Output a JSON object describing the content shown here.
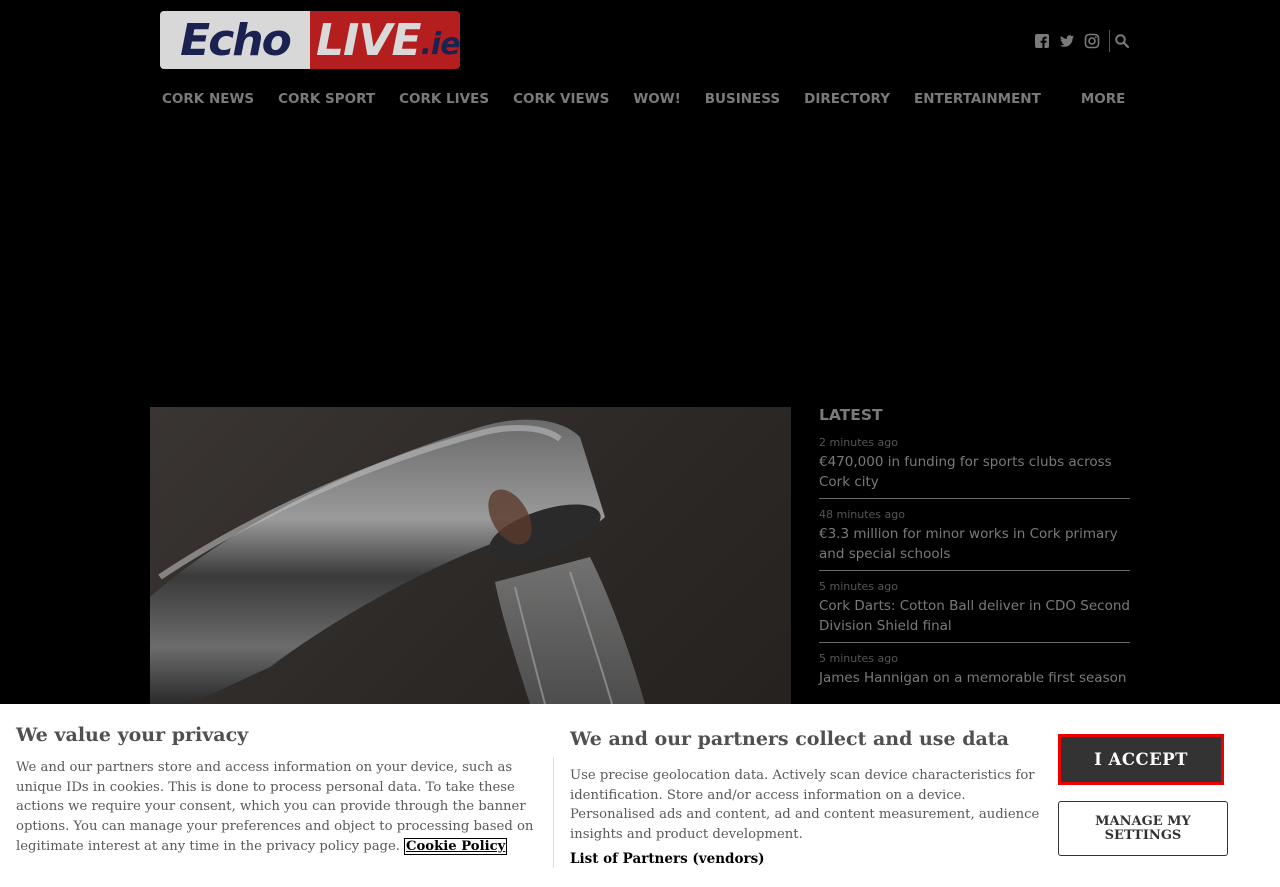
{
  "logo": {
    "part1": "Echo",
    "part2": "LIVE",
    "part3": ".ie"
  },
  "social": {
    "icons": [
      "facebook-icon",
      "twitter-icon",
      "instagram-icon",
      "search-icon"
    ]
  },
  "nav": {
    "items": [
      "CORK NEWS",
      "CORK SPORT",
      "CORK LIVES",
      "CORK VIEWS",
      "WOW!",
      "BUSINESS",
      "DIRECTORY",
      "ENTERTAINMENT"
    ],
    "more": "MORE"
  },
  "latest": {
    "heading": "LATEST",
    "entries": [
      {
        "time": "2 minutes ago",
        "title": "€470,000 in funding for sports clubs across Cork city"
      },
      {
        "time": "48 minutes ago",
        "title": "€3.3 million for minor works in Cork primary and special schools"
      },
      {
        "time": "5 minutes ago",
        "title": "Cork Darts: Cotton Ball deliver in CDO Second Division Shield final"
      },
      {
        "time": "5 minutes ago",
        "title": "James Hannigan on a memorable first season"
      }
    ]
  },
  "consent": {
    "left_title": "We value your privacy",
    "left_text": "We and our partners store and access information on your device, such as unique IDs in cookies. This is done to process personal data. To take these actions we require your consent, which you can provide through the banner options. You can manage your preferences and object to processing based on legitimate interest at any time in the privacy policy page.",
    "cookie_link": "Cookie Policy",
    "mid_title": "We and our partners collect and use data",
    "mid_text": "Use precise geolocation data. Actively scan device characteristics for identification. Store and/or access information on a device. Personalised ads and content, ad and content measurement, audience insights and product development.",
    "partners_link": "List of Partners (vendors)",
    "accept_label": "I ACCEPT",
    "manage_label": "MANAGE MY SETTINGS"
  },
  "colors": {
    "accept_border": "#ee0000",
    "accept_bg": "#333333",
    "overlay": "#000000"
  }
}
